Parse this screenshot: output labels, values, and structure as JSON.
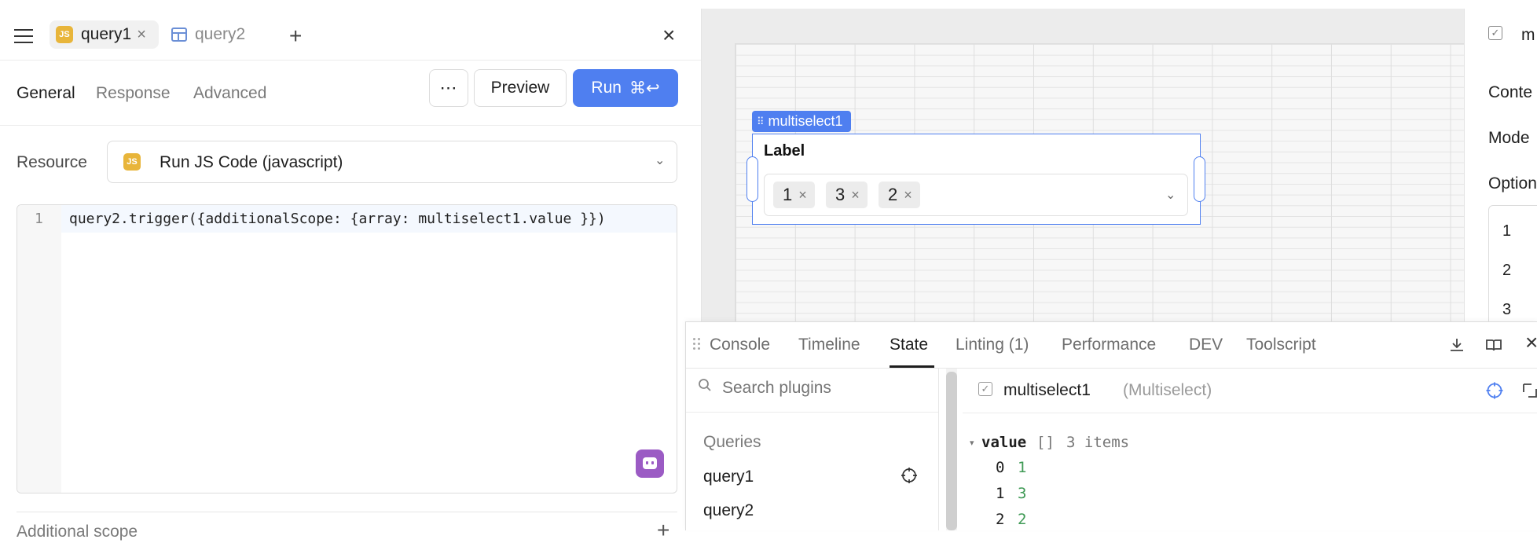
{
  "tabs": [
    {
      "label": "query1",
      "type": "js",
      "active": true,
      "badge": "JS"
    },
    {
      "label": "query2",
      "type": "table",
      "active": false
    }
  ],
  "icons": {
    "menu": "hamburger-menu-icon",
    "add": "+",
    "close": "×",
    "tab_close": "×",
    "more": "⋯",
    "run_shortcut": "⌘↩",
    "chevron_down": "⌄",
    "checkbox": "✓",
    "collapse": "▾",
    "chip_remove": "×",
    "drag_dots": "⠿"
  },
  "query_editor": {
    "subtabs": [
      "General",
      "Response",
      "Advanced"
    ],
    "active_subtab": "General",
    "preview_label": "Preview",
    "run_label": "Run",
    "resource_label": "Resource",
    "resource_value": "Run JS Code (javascript)",
    "resource_badge": "JS",
    "code_lines": [
      {
        "num": "1",
        "text": "query2.trigger({additionalScope: {array: multiselect1.value }})"
      }
    ],
    "additional_scope_label": "Additional scope"
  },
  "canvas": {
    "component_tag": "multiselect1",
    "component_label": "Label",
    "chips": [
      "1",
      "3",
      "2"
    ]
  },
  "inspector": {
    "title_partial": "m",
    "section_content": "Conte",
    "section_mode": "Mode",
    "section_options": "Option",
    "options": [
      "1",
      "2",
      "3"
    ]
  },
  "debug": {
    "tabs": [
      "Console",
      "Timeline",
      "State",
      "Linting (1)",
      "Performance",
      "DEV",
      "Toolscript"
    ],
    "active_tab": "State",
    "search_placeholder": "Search plugins",
    "queries_heading": "Queries",
    "queries": [
      "query1",
      "query2"
    ],
    "selected_name": "multiselect1",
    "selected_type": "(Multiselect)",
    "value_key": "value",
    "value_brackets": "[]",
    "value_count": "3 items",
    "value_items": [
      {
        "index": "0",
        "value": "1"
      },
      {
        "index": "1",
        "value": "3"
      },
      {
        "index": "2",
        "value": "2"
      }
    ]
  },
  "colors": {
    "accent": "#4f7ff0",
    "js_badge": "#e8b53a",
    "ai_button": "#9b5bc4",
    "state_value": "#3f9a55"
  }
}
